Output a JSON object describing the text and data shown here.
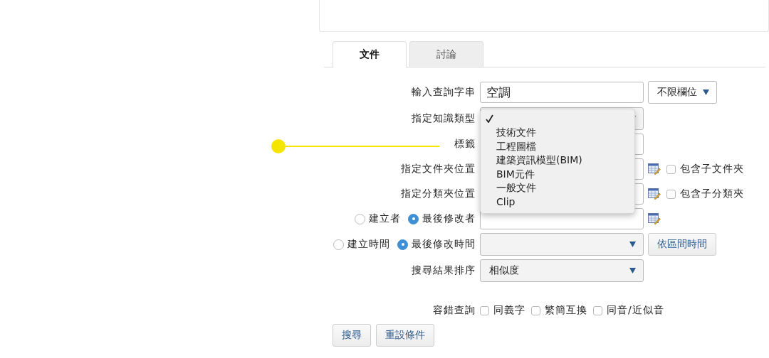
{
  "tabs": [
    {
      "label": "文件",
      "selected": true
    },
    {
      "label": "討論",
      "selected": false
    }
  ],
  "form": [
    {
      "label": "輸入查詢字串",
      "kind": "text",
      "value": "空調",
      "side_select": {
        "value": "不限欄位"
      }
    },
    {
      "label": "指定知識類型",
      "kind": "select",
      "menu": {
        "blank_selected": true,
        "options": [
          "技術文件",
          "工程圖檔",
          "建築資訊模型(BIM)",
          "BIM元件",
          "一般文件",
          "Clip"
        ]
      }
    },
    {
      "label": "標籤",
      "kind": "text"
    },
    {
      "label": "指定文件夾位置",
      "kind": "text",
      "picker": true,
      "checkbox": {
        "label": "包含子文件夾",
        "checked": false
      }
    },
    {
      "label": "指定分類夾位置",
      "kind": "text",
      "picker": true,
      "checkbox": {
        "label": "包含子分類夾",
        "checked": false
      }
    },
    {
      "radios": [
        {
          "label": "建立者",
          "selected": false
        },
        {
          "label": "最後修改者",
          "selected": true
        }
      ],
      "kind": "text",
      "picker": true
    },
    {
      "radios": [
        {
          "label": "建立時間",
          "selected": false
        },
        {
          "label": "最後修改時間",
          "selected": true
        }
      ],
      "kind": "select",
      "button": "依區間時間"
    },
    {
      "label": "搜尋結果排序",
      "kind": "select",
      "value": "相似度"
    }
  ],
  "fuzzy": {
    "label": "容錯查詢",
    "options": [
      {
        "label": "同義字",
        "checked": false
      },
      {
        "label": "繁簡互換",
        "checked": false
      },
      {
        "label": "同音/近似音",
        "checked": false
      }
    ]
  },
  "buttons": [
    "搜尋",
    "重設條件"
  ]
}
